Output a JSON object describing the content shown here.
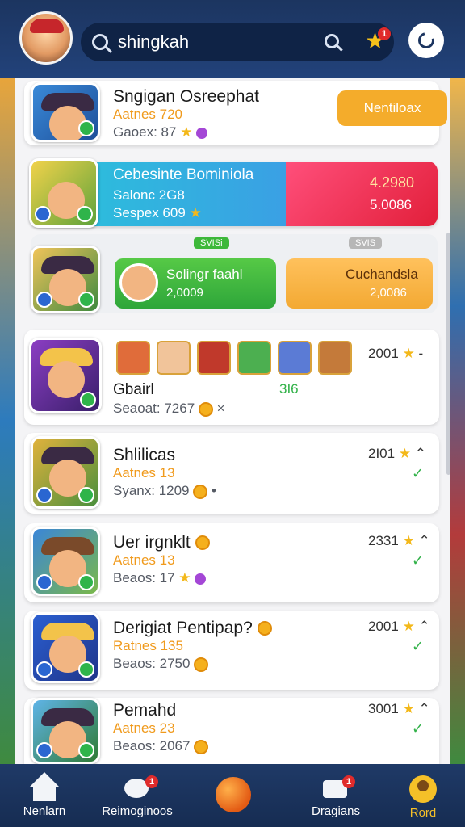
{
  "search": {
    "query": "shingkah",
    "notification_count": "1"
  },
  "rows": [
    {
      "title": "Sngigan Osreephat",
      "sub1": "Aatnes 720",
      "sub2": "Gaoex: 87",
      "button": "Nentiloax"
    },
    {
      "title": "Cebesinte Bominiola",
      "sub1": "Salonc 2G8",
      "sub2": "Sespex 609",
      "right_top": "4.2980",
      "right_bottom": "5.0086"
    },
    {
      "green_title": "Solingr faahl",
      "green_value": "2,0009",
      "orange_title": "Cuchandsla",
      "orange_value": "2,0086",
      "pill_left": "SVISi",
      "pill_right": "SVIS"
    },
    {
      "title": "Gbairl",
      "tag": "3I6",
      "sub2": "Seaoat: 7267",
      "rank": "2001"
    },
    {
      "title": "Shlilicas",
      "sub1": "Aatnes 13",
      "sub2": "Syanx: 1209",
      "rank": "2I01"
    },
    {
      "title": "Uer irgnklt",
      "sub1": "Aatnes 13",
      "sub2": "Beaos: 17",
      "rank": "2331"
    },
    {
      "title": "Derigiat Pentipap?",
      "sub1": "Ratnes 135",
      "sub2": "Beaos: 2750",
      "rank": "2001"
    },
    {
      "title": "Pemahd",
      "sub1": "Aatnes 23",
      "sub2": "Beaos: 2067",
      "rank": "3001"
    }
  ],
  "nav": {
    "home": "Nenlarn",
    "chat": "Reimoginoos",
    "chat_badge": "1",
    "messages": "Dragians",
    "messages_badge": "1",
    "profile": "Rord"
  },
  "colors": {
    "accent_orange": "#f4ac2b",
    "accent_green": "#33b24a",
    "nav_bg": "#1f3a67"
  },
  "icons": [
    "search-icon",
    "star-icon",
    "refresh-icon",
    "home-icon",
    "chat-icon",
    "ball-icon",
    "messages-icon",
    "profile-icon"
  ]
}
